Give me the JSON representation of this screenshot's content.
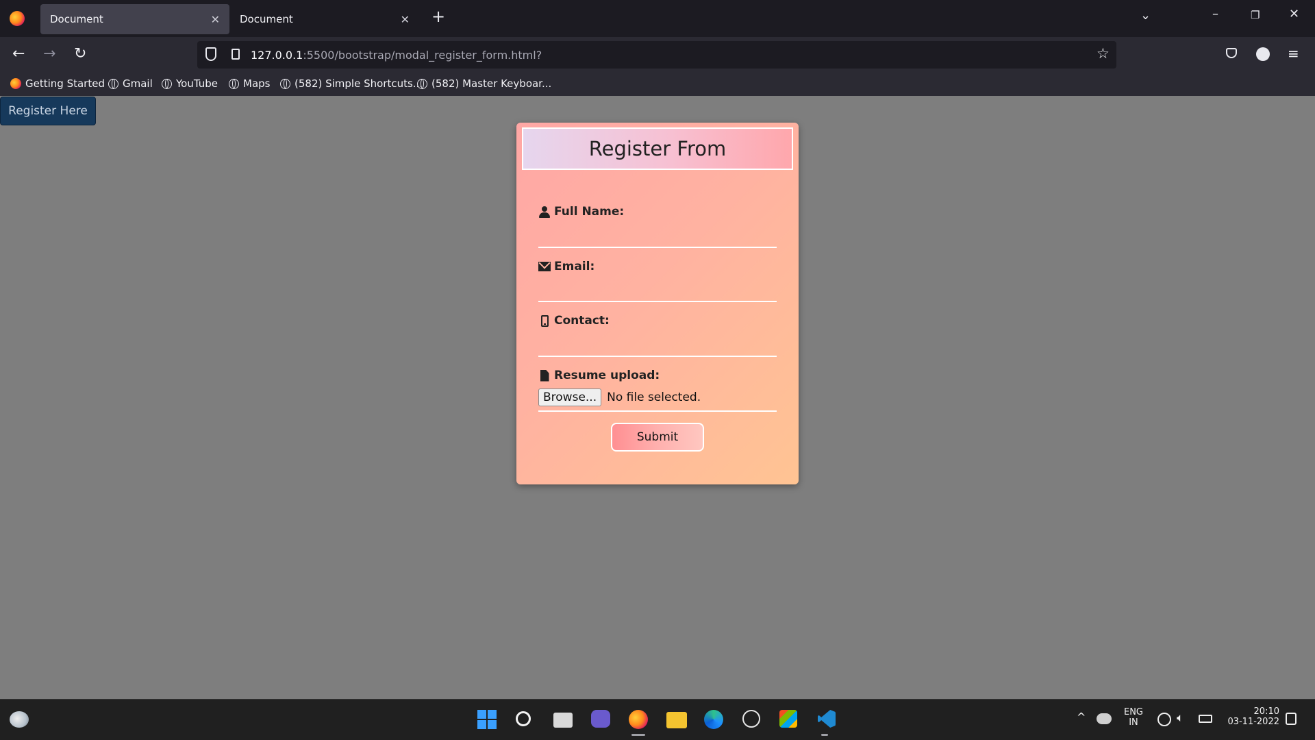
{
  "browser": {
    "tabs": [
      {
        "title": "Document",
        "active": true
      },
      {
        "title": "Document",
        "active": false
      }
    ],
    "url_host": "127.0.0.1",
    "url_rest": ":5500/bootstrap/modal_register_form.html?",
    "bookmarks": [
      {
        "label": "Getting Started",
        "icon": "firefox-icon"
      },
      {
        "label": "Gmail",
        "icon": "globe-icon"
      },
      {
        "label": "YouTube",
        "icon": "globe-icon"
      },
      {
        "label": "Maps",
        "icon": "globe-icon"
      },
      {
        "label": "(582) Simple Shortcuts...",
        "icon": "globe-icon"
      },
      {
        "label": "(582) Master Keyboar...",
        "icon": "globe-icon"
      }
    ]
  },
  "page": {
    "register_button": "Register Here",
    "modal": {
      "title": "Register From",
      "fields": [
        {
          "label": "Full Name:",
          "icon": "user-icon"
        },
        {
          "label": "Email:",
          "icon": "envelope-icon"
        },
        {
          "label": "Contact:",
          "icon": "phone-icon"
        },
        {
          "label": "Resume upload:",
          "icon": "file-icon"
        }
      ],
      "browse_label": "Browse...",
      "no_file_text": "No file selected.",
      "submit_label": "Submit"
    }
  },
  "taskbar": {
    "lang_top": "ENG",
    "lang_bottom": "IN",
    "time": "20:10",
    "date": "03-11-2022"
  },
  "colors": {
    "page_bg": "#7e7e7e",
    "modal_gradient_start": "#ffa7a5",
    "modal_gradient_end": "#ffc493",
    "register_button_bg": "#16395b"
  }
}
